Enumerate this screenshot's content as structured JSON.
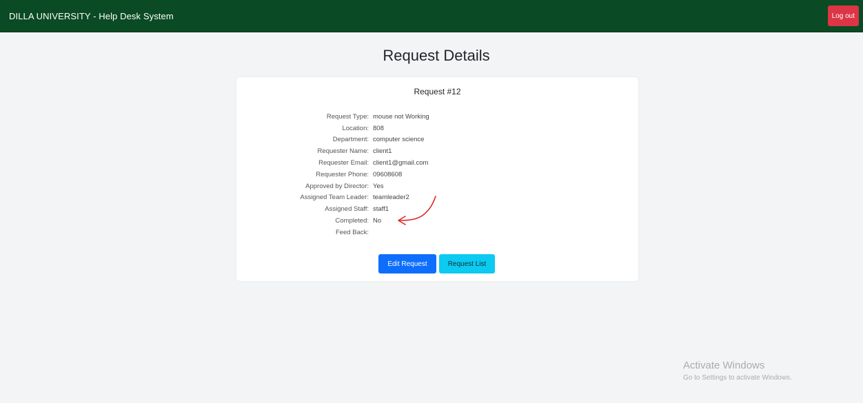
{
  "header": {
    "brand": "DILLA UNIVERSITY - Help Desk System",
    "logout_label": "Log out"
  },
  "page_title": "Request Details",
  "request": {
    "title": "Request #12",
    "fields": [
      {
        "label": "Request Type:",
        "value": "mouse not Working"
      },
      {
        "label": "Location:",
        "value": "808"
      },
      {
        "label": "Department:",
        "value": "computer science"
      },
      {
        "label": "Requester Name:",
        "value": "client1"
      },
      {
        "label": "Requester Email:",
        "value": "client1@gmail.com"
      },
      {
        "label": "Requester Phone:",
        "value": "09608608"
      },
      {
        "label": "Approved by Director:",
        "value": "Yes"
      },
      {
        "label": "Assigned Team Leader:",
        "value": "teamleader2"
      },
      {
        "label": "Assigned Staff:",
        "value": "staff1"
      },
      {
        "label": "Completed:",
        "value": "No"
      },
      {
        "label": "Feed Back:",
        "value": ""
      }
    ]
  },
  "actions": {
    "edit_label": "Edit Request",
    "list_label": "Request List"
  },
  "watermark": {
    "title": "Activate Windows",
    "subtitle": "Go to Settings to activate Windows."
  },
  "colors": {
    "navbar": "#0a4a24",
    "danger": "#dc3545",
    "primary": "#0d6efd",
    "info": "#0dcaf0",
    "annotation": "#e02020"
  }
}
